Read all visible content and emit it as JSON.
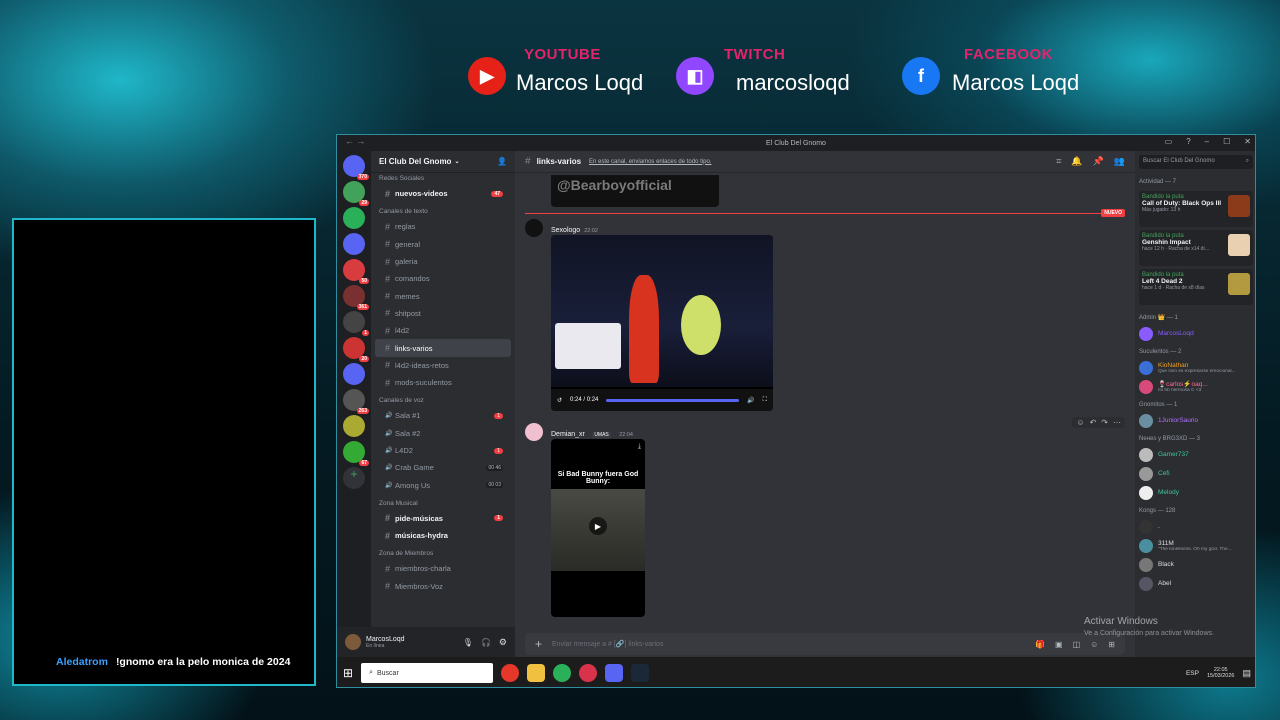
{
  "overlay": {
    "youtube": {
      "label": "YOUTUBE",
      "name": "Marcos Loqd"
    },
    "twitch": {
      "label": "TWITCH",
      "name": "marcosloqd"
    },
    "facebook": {
      "label": "FACEBOOK",
      "name": "Marcos Loqd"
    },
    "chat": {
      "user": "Aledatrom",
      "text": "!gnomo era la pelo monica de 2024"
    }
  },
  "window": {
    "title": "El Club Del Gnomo"
  },
  "guild_badges": [
    "370",
    "29",
    "",
    "",
    "50",
    "361",
    "1",
    "20",
    "",
    "263",
    "",
    "67"
  ],
  "server": {
    "name": "El Club Del Gnomo"
  },
  "channels": {
    "top_category": "Redes Sociales",
    "top_channel": {
      "name": "nuevos-videos",
      "badge": "47"
    },
    "text_category": "Canales de texto",
    "text": [
      {
        "name": "reglas"
      },
      {
        "name": "general"
      },
      {
        "name": "galeria"
      },
      {
        "name": "comandos"
      },
      {
        "name": "memes"
      },
      {
        "name": "shitpost"
      },
      {
        "name": "l4d2"
      },
      {
        "name": "links-varios"
      },
      {
        "name": "l4d2-ideas-retos"
      },
      {
        "name": "mods-suculentos"
      }
    ],
    "voice_category": "Canales de voz",
    "voice": [
      {
        "name": "Sala #1",
        "badge": "1"
      },
      {
        "name": "Sala #2",
        "badge": ""
      },
      {
        "name": "L4D2",
        "badge": "1"
      },
      {
        "name": "Crab Game",
        "cnt": "00 46"
      },
      {
        "name": "Among Us",
        "cnt": "00 03"
      }
    ],
    "music_category": "Zona Musical",
    "music": [
      {
        "name": "pide-músicas",
        "badge": "1"
      },
      {
        "name": "músicas-hydra",
        "badge": ""
      }
    ],
    "members_category": "Zona de Miembros",
    "members_ch": [
      {
        "name": "miembros-charla"
      },
      {
        "name": "Miembros-Voz"
      }
    ]
  },
  "user": {
    "name": "MarcosLoqd",
    "status": "En línea"
  },
  "chat_header": {
    "channel": "links-varios",
    "topic": "En este canal, enviamos enlaces de todo tipo."
  },
  "messages": {
    "banner_text": "@Bearboyofficial",
    "new_tag": "NUEVO",
    "m1": {
      "author": "Sexologo",
      "time": "22:02",
      "video_time": "0:24 / 0:24"
    },
    "m2": {
      "author": "Demian_xr",
      "tag": "UMAS",
      "time": "22:04",
      "video_caption": "Si Bad Bunny fuera God Bunny:"
    }
  },
  "composer": {
    "placeholder": "Enviar mensaje a #  [🔗] links-varios"
  },
  "members": {
    "search": "Buscar El Club Del Gnomo",
    "activity_label": "Actividad — 7",
    "activities": [
      {
        "who": "Bandido la puta",
        "game": "Call of Duty: Black Ops III",
        "meta": "Más jugado: 13 h"
      },
      {
        "who": "Bandido la puta",
        "game": "Genshin Impact",
        "meta": "hace 12 h · Racha de x14 dí..."
      },
      {
        "who": "Bandido la puta",
        "game": "Left 4 Dead 2",
        "meta": "hace 1 d · Racha de x8 días"
      }
    ],
    "groups": [
      {
        "label": "Admin 👑 — 1",
        "members": [
          {
            "name": "MarcosLoqd",
            "color": "#8a5cff",
            "status": ""
          }
        ]
      },
      {
        "label": "Suculentos — 2",
        "members": [
          {
            "name": "KioNathan",
            "color": "#f0a020",
            "status": "Que raro es expresarse emocional..."
          },
          {
            "name": "🍷carlos⚡oaq...",
            "color": "#ff6b9a",
            "status": "mi bb hermosa C <3"
          }
        ]
      },
      {
        "label": "Gnomitos — 1",
        "members": [
          {
            "name": "1JuniorSaurio",
            "color": "#b070ff",
            "status": ""
          }
        ]
      },
      {
        "label": "Neнes y BRG3XD — 3",
        "members": [
          {
            "name": "Gamer737",
            "color": "#43c2a0",
            "status": ""
          },
          {
            "name": "Cefi",
            "color": "#43c2a0",
            "status": ""
          },
          {
            "name": "Melody",
            "color": "#43c2a0",
            "status": ""
          }
        ]
      },
      {
        "label": "Kongs — 128",
        "members": [
          {
            "name": ".",
            "color": "#dbdee1",
            "status": ""
          },
          {
            "name": "311M",
            "color": "#dbdee1",
            "status": "\"The loneliness. Oh my god. The..."
          },
          {
            "name": "Black",
            "color": "#dbdee1",
            "status": ""
          },
          {
            "name": "Abel",
            "color": "#dbdee1",
            "status": ""
          }
        ]
      }
    ]
  },
  "taskbar": {
    "search": "Buscar",
    "lang": "ESP",
    "time": "22:05",
    "date": "15/03/2026"
  },
  "watermark": {
    "line1": "Activar Windows",
    "line2": "Ve a Configuración para activar Windows."
  }
}
